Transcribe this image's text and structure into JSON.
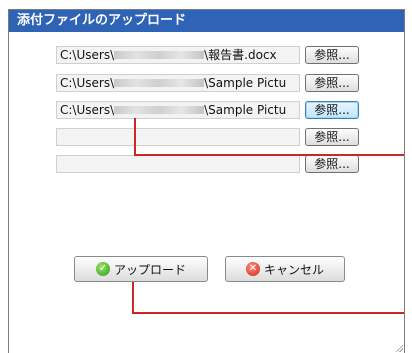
{
  "dialog": {
    "title": "添付ファイルのアップロード"
  },
  "files": [
    {
      "path_prefix": "C:\\Users\\",
      "path_suffix": "\\報告書.docx"
    },
    {
      "path_prefix": "C:\\Users\\",
      "path_suffix": "\\Sample Pictu"
    },
    {
      "path_prefix": "C:\\Users\\",
      "path_suffix": "\\Sample Pictu"
    },
    {
      "path_prefix": "",
      "path_suffix": ""
    },
    {
      "path_prefix": "",
      "path_suffix": ""
    }
  ],
  "browse_label": "参照...",
  "buttons": {
    "upload_label": "アップロード",
    "cancel_label": "キャンセル"
  },
  "colors": {
    "titlebar": "#2f63b6",
    "callout_line": "#cc2626"
  },
  "icons": {
    "upload": "check-circle-icon",
    "cancel": "x-circle-icon"
  }
}
